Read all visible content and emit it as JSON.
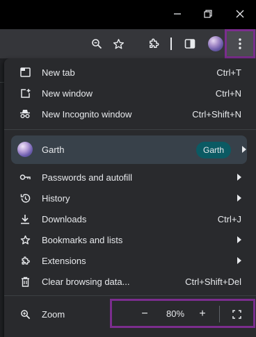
{
  "window": {
    "controls": [
      "minimize-icon",
      "restore-icon",
      "close-icon"
    ]
  },
  "toolbar": {
    "icons": [
      "zoom-icon",
      "bookmark-star-icon",
      "extensions-icon",
      "side-panel-icon",
      "profile-avatar",
      "more-menu-icon"
    ]
  },
  "menu": {
    "items_top": [
      {
        "label": "New tab",
        "shortcut": "Ctrl+T",
        "icon": "new-tab-icon"
      },
      {
        "label": "New window",
        "shortcut": "Ctrl+N",
        "icon": "new-window-icon"
      },
      {
        "label": "New Incognito window",
        "shortcut": "Ctrl+Shift+N",
        "icon": "incognito-icon"
      }
    ],
    "profile": {
      "label": "Garth",
      "chip": "Garth"
    },
    "items_main": [
      {
        "label": "Passwords and autofill",
        "icon": "key-icon",
        "submenu": true
      },
      {
        "label": "History",
        "icon": "history-icon",
        "submenu": true
      },
      {
        "label": "Downloads",
        "shortcut": "Ctrl+J",
        "icon": "download-icon"
      },
      {
        "label": "Bookmarks and lists",
        "icon": "star-icon",
        "submenu": true
      },
      {
        "label": "Extensions",
        "icon": "puzzle-icon",
        "submenu": true
      },
      {
        "label": "Clear browsing data...",
        "shortcut": "Ctrl+Shift+Del",
        "icon": "trash-icon"
      }
    ],
    "zoom": {
      "label": "Zoom",
      "minus": "−",
      "value": "80%",
      "plus": "+"
    }
  },
  "colors": {
    "highlight": "#7b2d8e",
    "menu_bg": "#292a2d",
    "profile_bg": "#38414a",
    "chip_bg": "#0b5a63"
  }
}
